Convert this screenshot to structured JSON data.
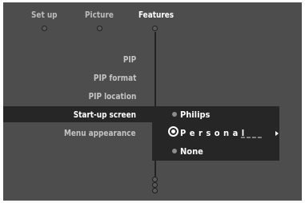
{
  "tabs": [
    {
      "label": "Set up",
      "active": false
    },
    {
      "label": "Picture",
      "active": false
    },
    {
      "label": "Features",
      "active": true
    }
  ],
  "menu": {
    "items": [
      {
        "label": "PIP"
      },
      {
        "label": "PIP format"
      },
      {
        "label": "PIP location"
      },
      {
        "label": "Start-up screen",
        "selected": true
      },
      {
        "label": "Menu appearance"
      }
    ]
  },
  "submenu": {
    "options": [
      {
        "label": "Philips",
        "selected": false
      },
      {
        "label": "Personal",
        "selected": true,
        "placeholder": "____"
      },
      {
        "label": "None",
        "selected": false
      }
    ]
  },
  "icons": {
    "tab_dot": "circle-dot-icon",
    "cursor": "focus-cursor-icon",
    "arrow": "right-arrow-icon",
    "scroll": "scroll-indicator-icon"
  },
  "colors": {
    "screen_bg": "#4d4d4d",
    "highlight_bg": "#262626",
    "active_text": "#ffffff",
    "dim_text": "#c4c4c4"
  }
}
